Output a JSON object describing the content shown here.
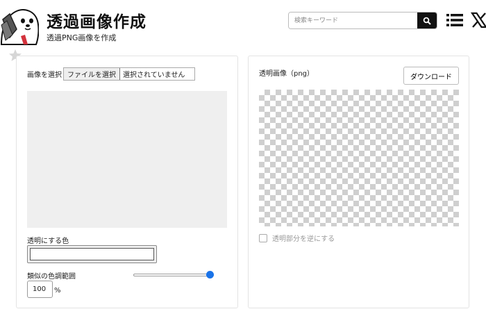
{
  "header": {
    "title": "透過画像作成",
    "subtitle": "透過PNG画像を作成",
    "search": {
      "placeholder": "検索キーワード",
      "value": ""
    },
    "icons": {
      "logo": "otter-mascot-logo",
      "star": "star-icon",
      "search": "search-icon",
      "menu": "list-menu-icon",
      "social": "x-logo-icon"
    }
  },
  "input_panel": {
    "file_label": "画像を選択",
    "file_button": "ファイルを選択",
    "file_status": "選択されていません",
    "color_label": "透明にする色",
    "color_value": "#ffffff",
    "range_label": "類似の色調範囲",
    "range_value": "100",
    "range_unit": "%",
    "slider_fraction": 1.0
  },
  "output_panel": {
    "label": "透明画像（png）",
    "download_button": "ダウンロード",
    "invert_label": "透明部分を逆にする",
    "invert_checked": false
  },
  "colors": {
    "accent": "#1a73e8",
    "search_button": "#111111",
    "preview_bg": "#efefef",
    "checker": "#cfcfcf"
  }
}
